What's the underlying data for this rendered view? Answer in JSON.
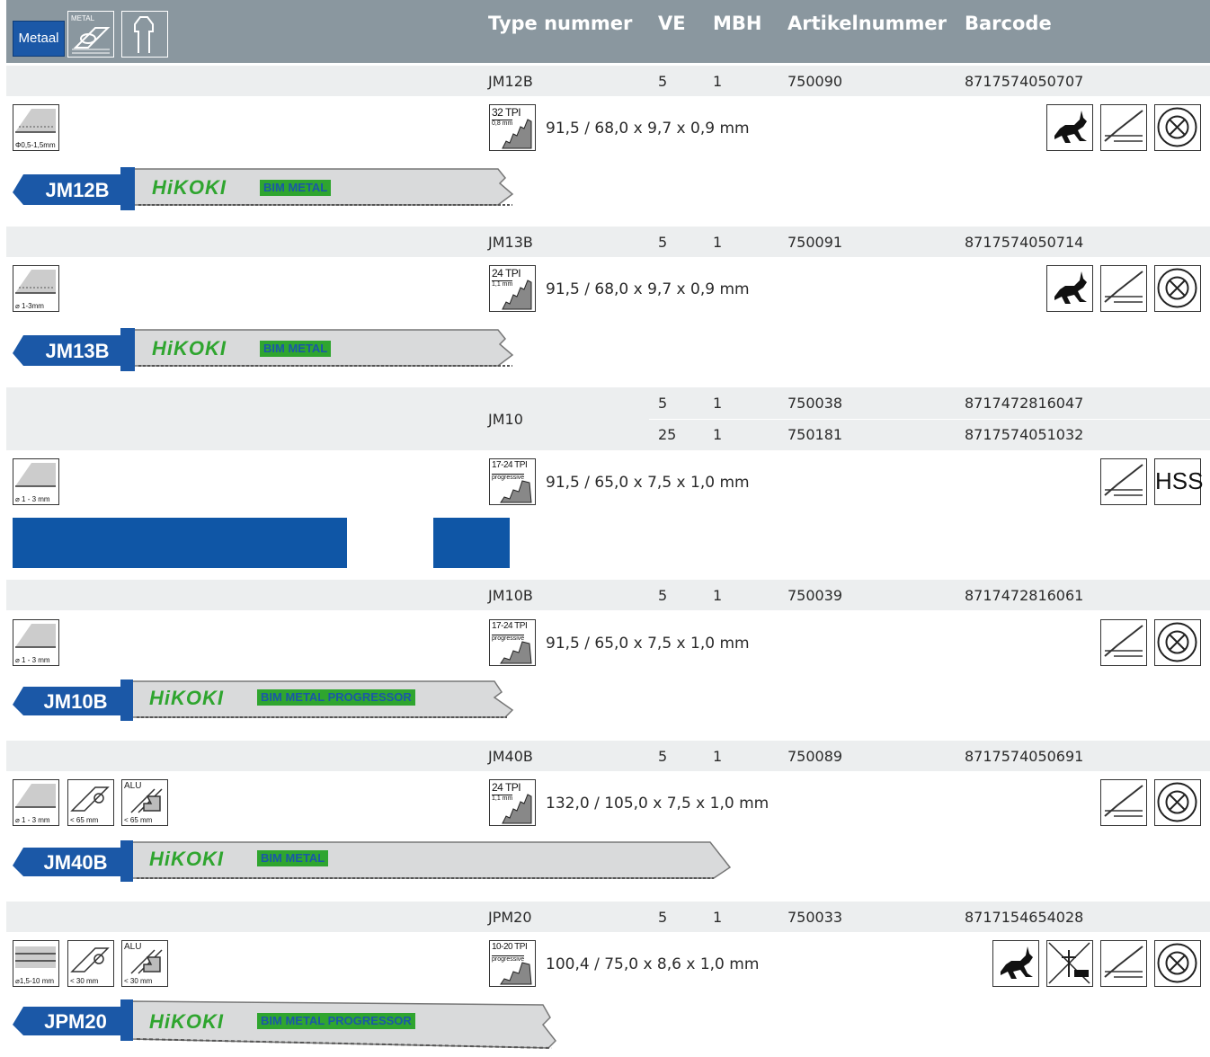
{
  "header": {
    "badge": "Metaal",
    "metal_icon_label": "METAL",
    "columns": [
      "Type nummer",
      "VE",
      "MBH",
      "Artikelnummer",
      "Barcode"
    ]
  },
  "products": [
    {
      "type": "JM12B",
      "rows": [
        {
          "ve": "5",
          "mbh": "1",
          "artikel": "750090",
          "barcode": "8717574050707"
        }
      ],
      "material_labels": [
        "Φ0,5-1,5mm"
      ],
      "tpi": "32 TPI",
      "tpi_sub": "0,8 mm",
      "dimensions": "91,5 / 68,0 x 9,7 x 0,9 mm",
      "features": [
        "rabbit-icon",
        "straight-cut-icon",
        "bi-metal-icon"
      ],
      "blade_tag": "JM12B",
      "blade_brand": "HiKOKI",
      "blade_spec": "BIM METAL"
    },
    {
      "type": "JM13B",
      "rows": [
        {
          "ve": "5",
          "mbh": "1",
          "artikel": "750091",
          "barcode": "8717574050714"
        }
      ],
      "material_labels": [
        "⌀ 1-3mm"
      ],
      "tpi": "24 TPI",
      "tpi_sub": "1,1 mm",
      "dimensions": "91,5 / 68,0 x 9,7 x 0,9 mm",
      "features": [
        "rabbit-icon",
        "straight-cut-icon",
        "bi-metal-icon"
      ],
      "blade_tag": "JM13B",
      "blade_brand": "HiKOKI",
      "blade_spec": "BIM METAL"
    },
    {
      "type": "JM10",
      "rows": [
        {
          "ve": "5",
          "mbh": "1",
          "artikel": "750038",
          "barcode": "8717472816047"
        },
        {
          "ve": "25",
          "mbh": "1",
          "artikel": "750181",
          "barcode": "8717574051032"
        }
      ],
      "material_labels": [
        "⌀ 1 - 3 mm"
      ],
      "tpi": "17-24 TPI",
      "tpi_sub": "progressive",
      "dimensions": "91,5 / 65,0 x 7,5 x 1,0 mm",
      "features": [
        "straight-cut-icon",
        "hss-icon"
      ],
      "hss_label": "HSS"
    },
    {
      "type": "JM10B",
      "rows": [
        {
          "ve": "5",
          "mbh": "1",
          "artikel": "750039",
          "barcode": "8717472816061"
        }
      ],
      "material_labels": [
        "⌀ 1 - 3 mm"
      ],
      "tpi": "17-24 TPI",
      "tpi_sub": "progressive",
      "dimensions": "91,5 / 65,0 x 7,5 x 1,0 mm",
      "features": [
        "straight-cut-icon",
        "bi-metal-icon"
      ],
      "blade_tag": "JM10B",
      "blade_brand": "HiKOKI",
      "blade_spec": "BIM METAL PROGRESSOR"
    },
    {
      "type": "JM40B",
      "rows": [
        {
          "ve": "5",
          "mbh": "1",
          "artikel": "750089",
          "barcode": "8717574050691"
        }
      ],
      "material_labels": [
        "⌀ 1 - 3 mm",
        "< 65 mm",
        "< 65 mm"
      ],
      "alu_label": "ALU",
      "tpi": "24 TPI",
      "tpi_sub": "1,1 mm",
      "dimensions": "132,0 / 105,0 x 7,5 x 1,0 mm",
      "features": [
        "straight-cut-icon",
        "bi-metal-icon"
      ],
      "blade_tag": "JM40B",
      "blade_brand": "HiKOKI",
      "blade_spec": "BIM METAL"
    },
    {
      "type": "JPM20",
      "rows": [
        {
          "ve": "5",
          "mbh": "1",
          "artikel": "750033",
          "barcode": "8717154654028"
        }
      ],
      "material_labels": [
        "⌀1,5-10 mm",
        "< 30 mm",
        "< 30 mm"
      ],
      "alu_label": "ALU",
      "tpi": "10-20 TPI",
      "tpi_sub": "progressive",
      "dimensions": "100,4 / 75,0 x 8,6 x 1,0 mm",
      "features": [
        "rabbit-icon",
        "no-bevel-icon",
        "straight-cut-icon",
        "bi-metal-icon"
      ],
      "blade_tag": "JPM20",
      "blade_brand": "HiKOKI",
      "blade_spec": "BIM METAL PROGRESSOR"
    }
  ],
  "colors": {
    "header_bg": "#8a979f",
    "band_bg": "#eceeef",
    "brand_blue": "#1b58a7",
    "brand_green": "#2fa52f"
  }
}
